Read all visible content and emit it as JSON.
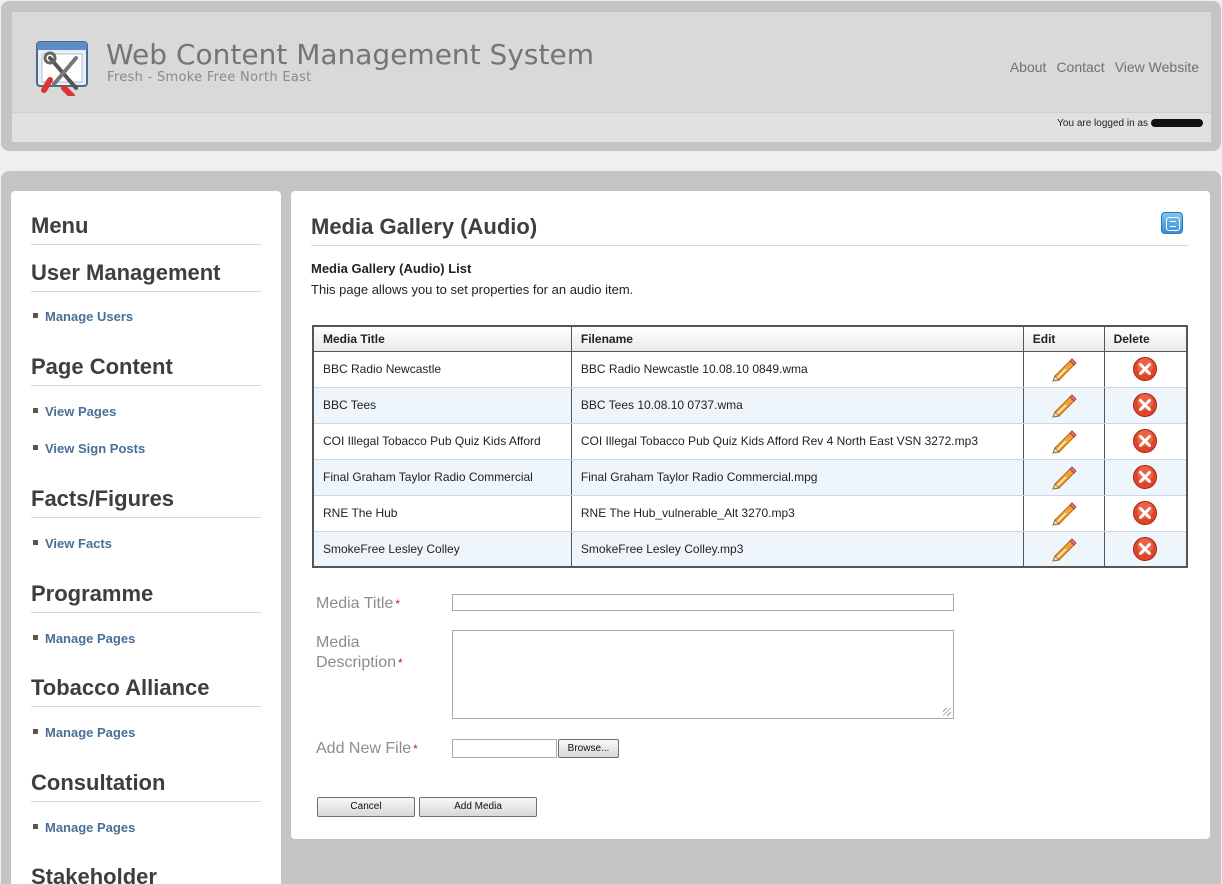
{
  "header": {
    "title": "Web Content Management System",
    "subtitle": "Fresh - Smoke Free North East",
    "nav": [
      "About",
      "Contact",
      "View Website"
    ],
    "login_text": "You are logged in as"
  },
  "sidebar": {
    "menu_title": "Menu",
    "sections": [
      {
        "heading": "User Management",
        "links": [
          "Manage Users"
        ]
      },
      {
        "heading": "Page Content",
        "links": [
          "View Pages",
          "View Sign Posts"
        ]
      },
      {
        "heading": "Facts/Figures",
        "links": [
          "View Facts"
        ]
      },
      {
        "heading": "Programme",
        "links": [
          "Manage Pages"
        ]
      },
      {
        "heading": "Tobacco Alliance",
        "links": [
          "Manage Pages"
        ]
      },
      {
        "heading": "Consultation",
        "links": [
          "Manage Pages"
        ]
      },
      {
        "heading": "Stakeholder",
        "links": []
      }
    ]
  },
  "main": {
    "page_title": "Media Gallery (Audio)",
    "list_title": "Media Gallery (Audio) List",
    "description": "This page allows you to set properties for an audio item.",
    "table": {
      "headers": [
        "Media Title",
        "Filename",
        "Edit",
        "Delete"
      ],
      "rows": [
        {
          "title": "BBC Radio Newcastle",
          "filename": "BBC Radio Newcastle 10.08.10 0849.wma"
        },
        {
          "title": "BBC Tees",
          "filename": "BBC Tees 10.08.10 0737.wma"
        },
        {
          "title": "COI Illegal Tobacco Pub Quiz Kids Afford",
          "filename": "COI Illegal Tobacco Pub Quiz Kids Afford Rev 4 North East VSN 3272.mp3"
        },
        {
          "title": "Final Graham Taylor Radio Commercial",
          "filename": "Final Graham Taylor Radio Commercial.mpg"
        },
        {
          "title": "RNE The Hub",
          "filename": "RNE The Hub_vulnerable_Alt 3270.mp3"
        },
        {
          "title": "SmokeFree Lesley Colley",
          "filename": "SmokeFree Lesley Colley.mp3"
        }
      ]
    },
    "form": {
      "media_title_label": "Media Title",
      "media_desc_label_1": "Media",
      "media_desc_label_2": "Description",
      "add_file_label": "Add New File",
      "required_mark": "*",
      "browse_label": "Browse...",
      "cancel_label": "Cancel",
      "add_media_label": "Add Media"
    }
  },
  "icons": {
    "logo": "tools-monitor-icon",
    "edit": "pencil-icon",
    "delete": "delete-x-icon",
    "view": "list-view-icon"
  },
  "colors": {
    "link": "#4a6f96",
    "heading": "#3e3e3e",
    "delete": "#e0452a",
    "required": "#c41a1a"
  }
}
